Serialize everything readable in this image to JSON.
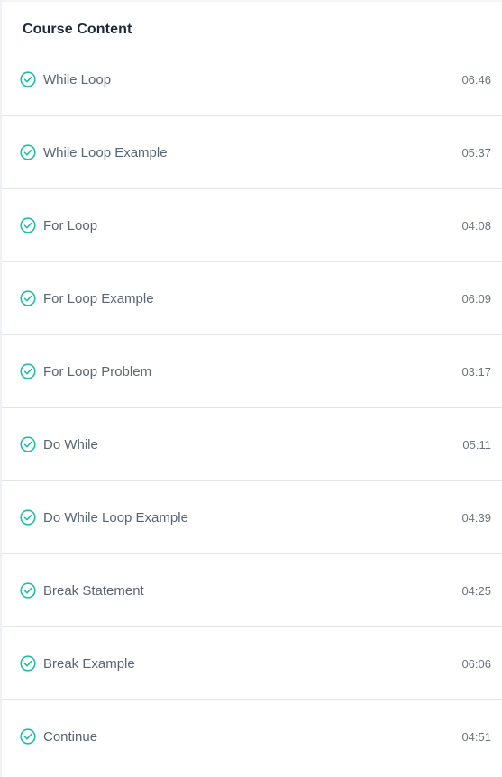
{
  "header": {
    "title": "Course Content"
  },
  "colors": {
    "check": "#1fbfa3",
    "text": "#5a6474",
    "divider": "#e2e6ea"
  },
  "items": [
    {
      "title": "While Loop",
      "duration": "06:46",
      "icon": "check-circle-icon"
    },
    {
      "title": "While Loop Example",
      "duration": "05:37",
      "icon": "check-circle-icon"
    },
    {
      "title": "For Loop",
      "duration": "04:08",
      "icon": "check-circle-icon"
    },
    {
      "title": "For Loop Example",
      "duration": "06:09",
      "icon": "check-circle-icon"
    },
    {
      "title": "For Loop Problem",
      "duration": "03:17",
      "icon": "check-circle-icon"
    },
    {
      "title": "Do While",
      "duration": "05:11",
      "icon": "check-circle-icon"
    },
    {
      "title": "Do While Loop Example",
      "duration": "04:39",
      "icon": "check-circle-icon"
    },
    {
      "title": "Break Statement",
      "duration": "04:25",
      "icon": "check-circle-icon"
    },
    {
      "title": "Break Example",
      "duration": "06:06",
      "icon": "check-circle-icon"
    },
    {
      "title": "Continue",
      "duration": "04:51",
      "icon": "check-circle-icon"
    }
  ]
}
